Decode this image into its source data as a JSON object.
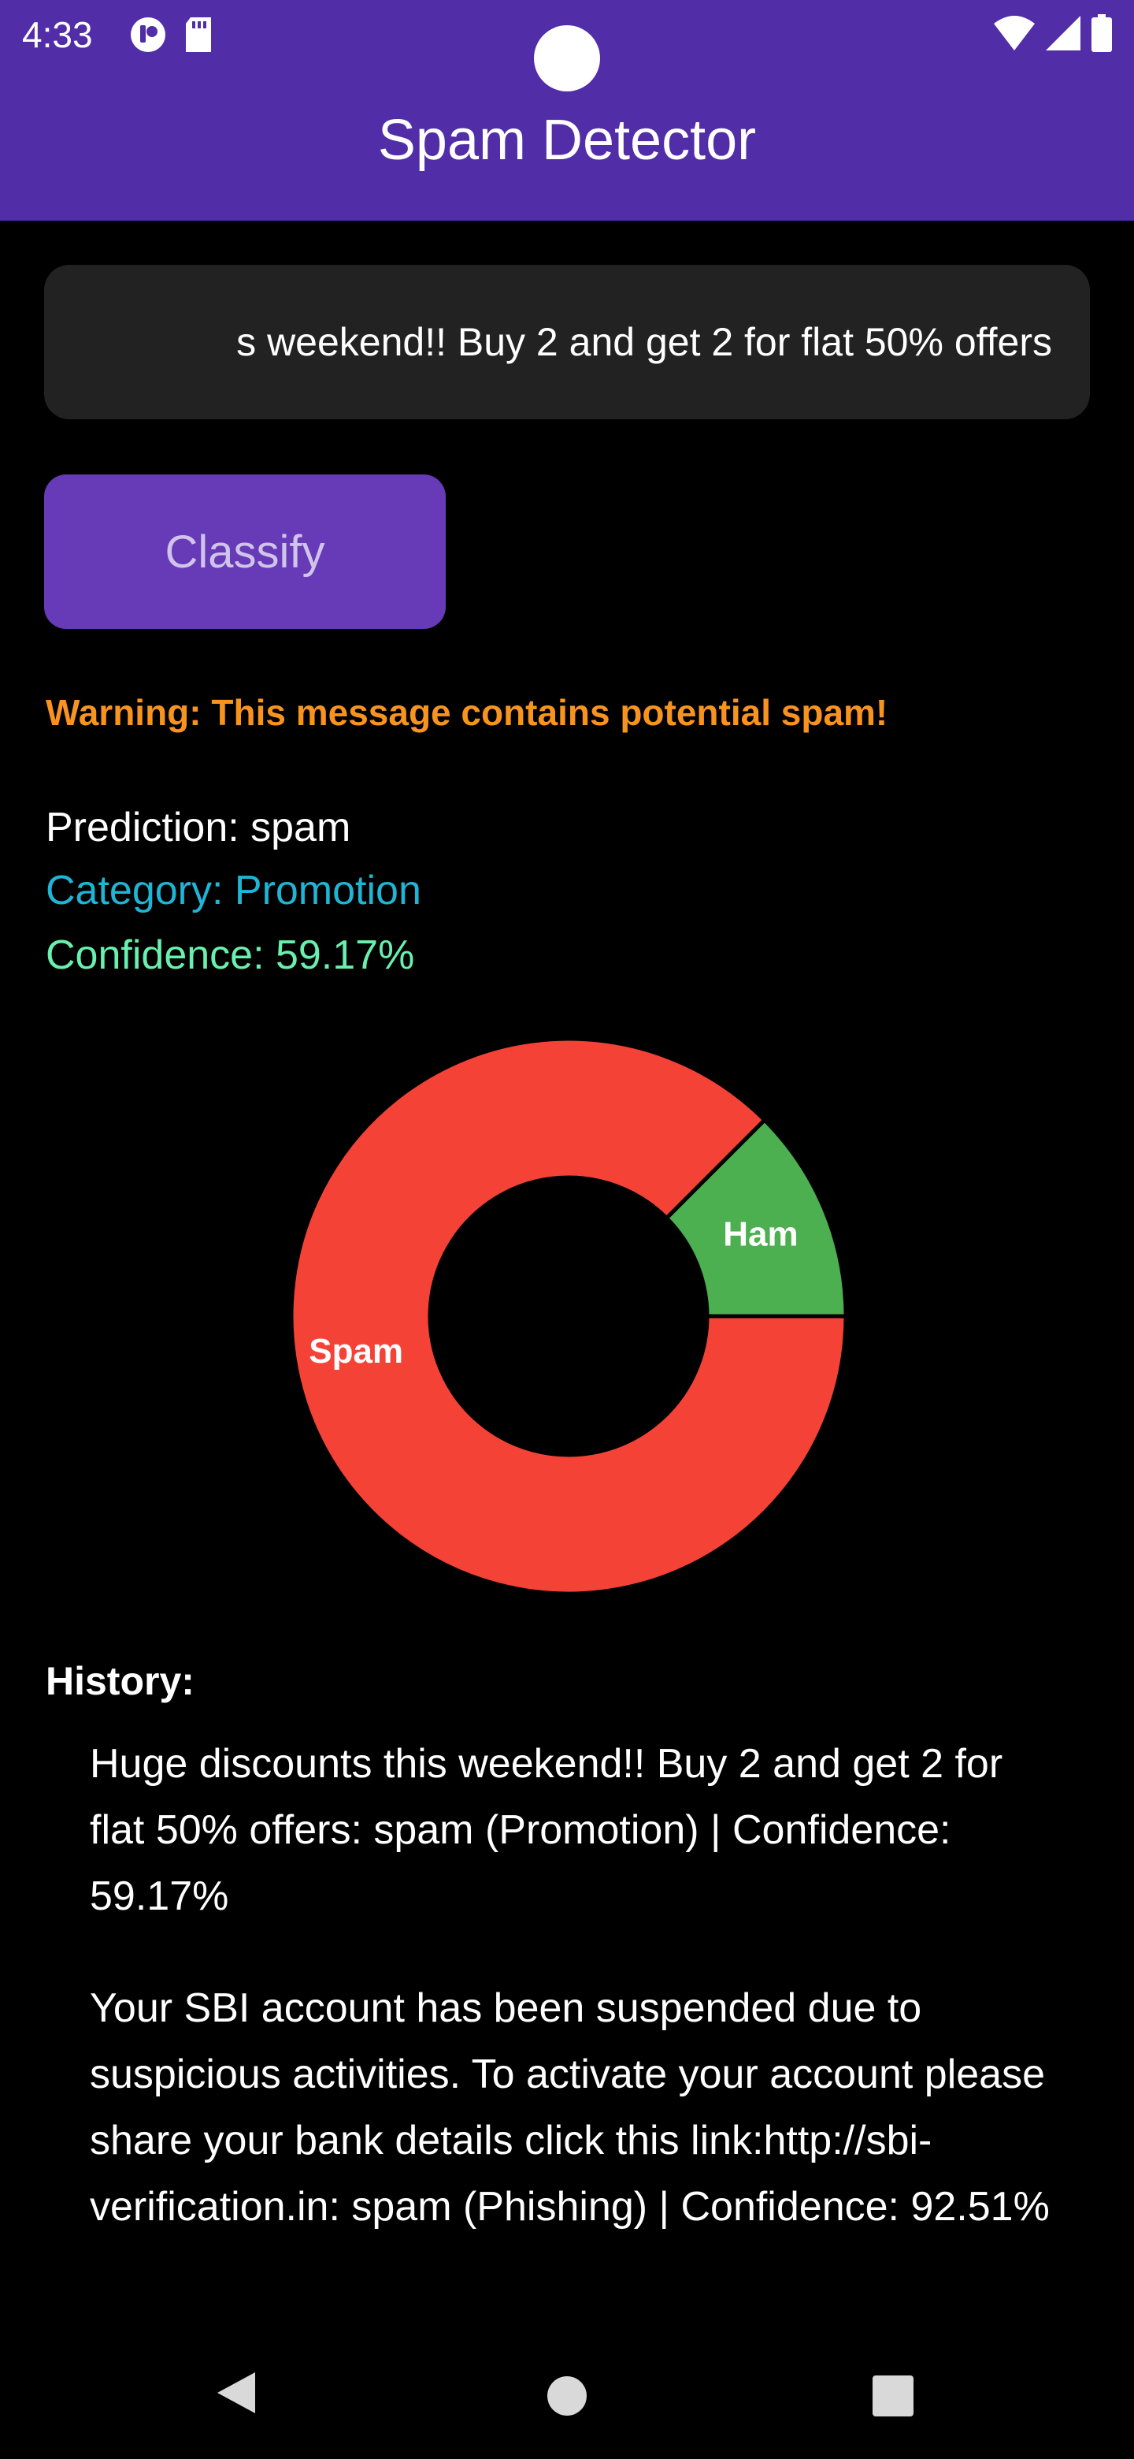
{
  "status_bar": {
    "time": "4:33"
  },
  "app_bar": {
    "title": "Spam Detector"
  },
  "input": {
    "value": "s weekend!! Buy 2 and get 2 for flat 50% offers"
  },
  "classify_button": {
    "label": "Classify"
  },
  "warning": "Warning: This message contains potential spam!",
  "results": {
    "prediction": "Prediction: spam",
    "category": "Category: Promotion",
    "confidence": "Confidence: 59.17%"
  },
  "chart_data": {
    "type": "pie",
    "donut": true,
    "title": "",
    "categories": [
      "Spam",
      "Ham"
    ],
    "values": [
      87.5,
      12.5
    ],
    "colors": [
      "#F44336",
      "#4CAF50"
    ],
    "legend": "none",
    "slice_labels": [
      "Spam",
      "Ham"
    ]
  },
  "history": {
    "heading": "History:",
    "items": [
      "Huge discounts this weekend!! Buy 2 and get 2 for flat 50% offers: spam (Promotion) | Confidence: 59.17%",
      "Your SBI account has been suspended due to suspicious activities. To activate your account please share your bank details click this link:http://sbi-verification.in: spam (Phishing) | Confidence: 92.51%"
    ]
  },
  "colors": {
    "app_bar": "#512DA8",
    "button": "#673AB7",
    "button_text": "#D1C4E9",
    "warning": "#F7931E",
    "category": "#1FB5D6",
    "confidence": "#69F0AE",
    "spam": "#F44336",
    "ham": "#4CAF50"
  },
  "icons": {
    "status_left": [
      "app-notification-icon",
      "sd-card-icon"
    ],
    "status_right": [
      "wifi-icon",
      "cell-signal-icon",
      "battery-icon"
    ],
    "nav": [
      "back-icon",
      "home-icon",
      "recents-icon"
    ]
  }
}
